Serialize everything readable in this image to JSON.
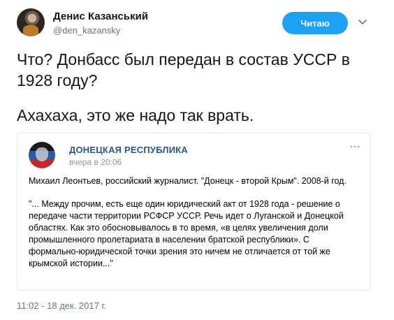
{
  "author": {
    "name": "Денис Казанський",
    "handle": "@den_kazansky",
    "avatar_icon": "user-avatar"
  },
  "follow_button": {
    "label": "Читаю"
  },
  "menu_icon": "chevron-down-icon",
  "tweet": {
    "line1": "Что? Донбасс был передан в состав УССР в 1928 году?",
    "line2": "Ахахаха, это же надо так врать."
  },
  "quoted_post": {
    "group_name": "ДОНЕЦКАЯ РЕСПУБЛИКА",
    "time": "вчера в 20:06",
    "menu_icon": "more-dots-icon",
    "paragraph1": "Михаил Леонтьев, российский журналист. \"Донецк - второй Крым\". 2008-й год.",
    "paragraph2": "\"... Между прочим, есть еще один юридический акт от 1928 года - решение о передаче части территории РСФСР УССР. Речь идет о Луганской и Донецкой областях. Как это обосновывалось в то время, «в целях увеличения доли промышленного пролетариата в населении братской республики». С формально-юридической точки зрения это ничем не отличается от той же крымской истории...\""
  },
  "timestamp": "11:02 - 18 дек. 2017 г.",
  "colors": {
    "accent": "#1da1f2",
    "vk_link": "#2a5885",
    "secondary_text": "#657786"
  }
}
